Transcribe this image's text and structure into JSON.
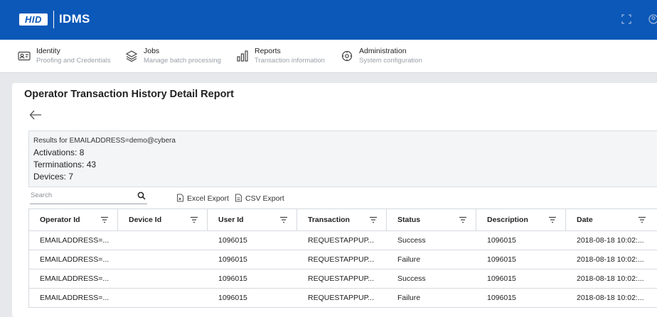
{
  "app": {
    "logo": "HID",
    "name": "IDMS"
  },
  "nav": [
    {
      "title": "Identity",
      "subtitle": "Proofing and Credentials",
      "icon": "id-card-icon"
    },
    {
      "title": "Jobs",
      "subtitle": "Manage batch processing",
      "icon": "layers-icon"
    },
    {
      "title": "Reports",
      "subtitle": "Transaction information",
      "icon": "bar-chart-icon"
    },
    {
      "title": "Administration",
      "subtitle": "System configuration",
      "icon": "gear-icon"
    }
  ],
  "page": {
    "title": "Operator Transaction History Detail Report"
  },
  "results": {
    "query": "Results for EMAILADDRESS=demo@cybera",
    "activations": "Activations: 8",
    "terminations": "Terminations: 43",
    "devices": "Devices: 7"
  },
  "search": {
    "placeholder": "Search"
  },
  "exports": {
    "excel": "Excel Export",
    "csv": "CSV Export"
  },
  "table": {
    "columns": [
      "Operator Id",
      "Device Id",
      "User Id",
      "Transaction",
      "Status",
      "Description",
      "Date"
    ],
    "rows": [
      [
        "EMAILADDRESS=...",
        "",
        "1096015",
        "REQUESTAPPUP...",
        "Success",
        "1096015",
        "2018-08-18 10:02:..."
      ],
      [
        "EMAILADDRESS=...",
        "",
        "1096015",
        "REQUESTAPPUP...",
        "Failure",
        "1096015",
        "2018-08-18 10:02:..."
      ],
      [
        "EMAILADDRESS=...",
        "",
        "1096015",
        "REQUESTAPPUP...",
        "Success",
        "1096015",
        "2018-08-18 10:02:..."
      ],
      [
        "EMAILADDRESS=...",
        "",
        "1096015",
        "REQUESTAPPUP...",
        "Failure",
        "1096015",
        "2018-08-18 10:02:..."
      ]
    ]
  },
  "colors": {
    "header": "#0b58b8",
    "background": "#e6e8ec"
  }
}
